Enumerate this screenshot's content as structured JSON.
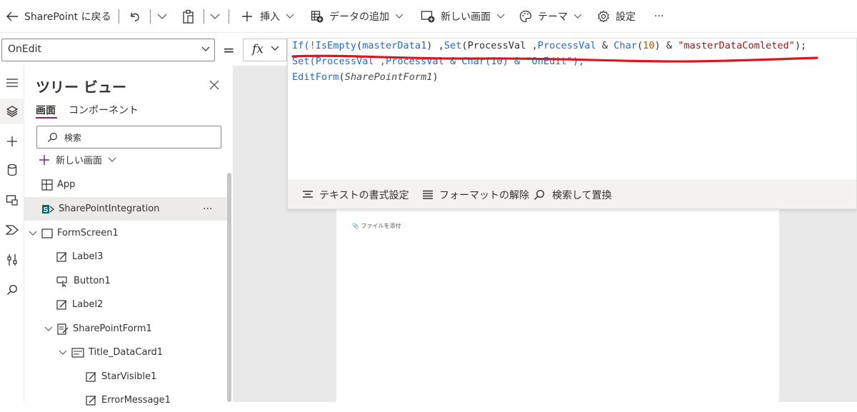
{
  "header": {
    "back_label": "SharePoint に戻る",
    "insert_label": "挿入",
    "add_data_label": "データの追加",
    "new_screen_label": "新しい画面",
    "theme_label": "テーマ",
    "settings_label": "設定",
    "more_label": "···"
  },
  "formula_bar": {
    "property": "OnEdit",
    "equals": "=",
    "fx_label": "fx"
  },
  "editor": {
    "line1": {
      "p1": "If(!",
      "p2": "IsEmpty",
      "p3": "(",
      "p4": "masterData1",
      "p5": ") ,",
      "p6": "Set",
      "p7": "(ProcessVal ,",
      "p8": "ProcessVal",
      "p9": " & ",
      "p10": "Char",
      "p11": "(",
      "p12": "10",
      "p13": ") & ",
      "p14": "\"masterDataComleted\"",
      "p15": ");"
    },
    "line2": "Set(ProcessVal ,ProcessVal & Char(10) & \"OnEdit\");",
    "line3": {
      "p1": "EditForm",
      "p2": "(",
      "p3": "SharePointForm1",
      "p4": ")"
    },
    "toolbar": {
      "format_text": "テキストの書式設定",
      "remove_format": "フォーマットの解除",
      "find_replace": "検索して置換"
    }
  },
  "tree_view": {
    "title": "ツリー ビュー",
    "tab_screens": "画面",
    "tab_components": "コンポーネント",
    "search_placeholder": "検索",
    "new_screen": "新しい画面",
    "more": "···",
    "nodes": [
      {
        "label": "App",
        "icon": "app-icon"
      },
      {
        "label": "SharePointIntegration",
        "icon": "sharepoint-icon"
      },
      {
        "label": "FormScreen1",
        "icon": "screen-icon"
      },
      {
        "label": "Label3",
        "icon": "label-icon"
      },
      {
        "label": "Button1",
        "icon": "button-icon"
      },
      {
        "label": "Label2",
        "icon": "label-icon"
      },
      {
        "label": "SharePointForm1",
        "icon": "form-icon"
      },
      {
        "label": "Title_DataCard1",
        "icon": "datacard-icon"
      },
      {
        "label": "StarVisible1",
        "icon": "label-icon"
      },
      {
        "label": "ErrorMessage1",
        "icon": "label-icon"
      }
    ]
  },
  "canvas": {
    "attach_label": "ファイルを添付"
  },
  "colors": {
    "accent": "#742774",
    "formula_blue": "#1f6ad1",
    "annotation_red": "#e0141e"
  }
}
